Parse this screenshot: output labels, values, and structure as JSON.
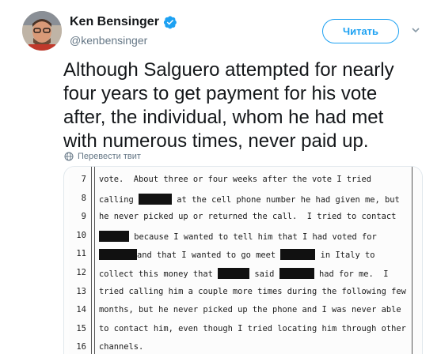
{
  "author": {
    "display_name": "Ken Bensinger",
    "handle": "@kenbensinger",
    "verified_icon": "verified-badge-icon"
  },
  "follow_button": {
    "label": "Читать"
  },
  "menu_icon": "chevron-down-icon",
  "tweet": {
    "text": "Although Salguero attempted for nearly four years to get payment for his vote after, the individual, whom he had met with numerous times, never paid up."
  },
  "translate": {
    "label": "Перевести твит",
    "icon": "globe-icon"
  },
  "transcript": {
    "lines": [
      {
        "num": "7",
        "parts": [
          "vote.  About three or four weeks after the vote I tried"
        ]
      },
      {
        "num": "8",
        "parts": [
          "calling ",
          "",
          " at the cell phone number he had given me, but"
        ]
      },
      {
        "num": "9",
        "parts": [
          "he never picked up or returned the call.  I tried to contact"
        ]
      },
      {
        "num": "10",
        "parts": [
          "",
          " because I wanted to tell him that I had voted for"
        ]
      },
      {
        "num": "11",
        "parts": [
          "",
          "and that I wanted to go meet ",
          "",
          " in Italy to"
        ]
      },
      {
        "num": "12",
        "parts": [
          "collect this money that ",
          "",
          " said ",
          "",
          " had for me.  I"
        ]
      },
      {
        "num": "13",
        "parts": [
          "tried calling him a couple more times during the following few"
        ]
      },
      {
        "num": "14",
        "parts": [
          "months, but he never picked up the phone and I was never able"
        ]
      },
      {
        "num": "15",
        "parts": [
          "to contact him, even though I tried locating him through other"
        ]
      },
      {
        "num": "16",
        "parts": [
          "channels."
        ]
      }
    ]
  },
  "colors": {
    "accent": "#1da1f2",
    "text": "#14171a",
    "muted": "#657786"
  }
}
